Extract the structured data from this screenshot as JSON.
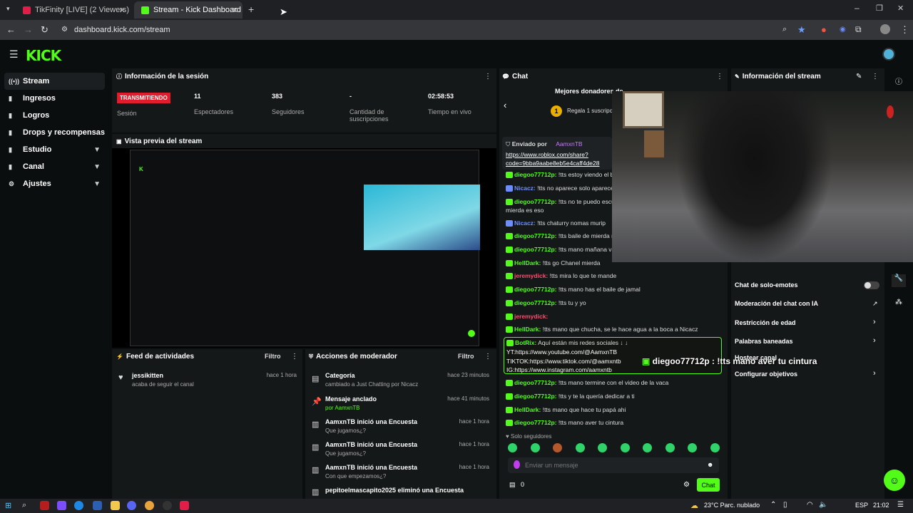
{
  "browser": {
    "tabs": [
      {
        "title": "TikFinity [LIVE] (2 Viewers)"
      },
      {
        "title": "Stream - Kick Dashboard"
      }
    ],
    "url": "dashboard.kick.com/stream"
  },
  "app": {
    "logo": "KICK"
  },
  "sidebar": {
    "items": [
      {
        "label": "Stream",
        "icon": "stream-icon"
      },
      {
        "label": "Ingresos",
        "icon": "money-icon"
      },
      {
        "label": "Logros",
        "icon": "trophy-icon"
      },
      {
        "label": "Drops y recompensas",
        "icon": "gift-icon"
      },
      {
        "label": "Estudio",
        "icon": "studio-icon"
      },
      {
        "label": "Canal",
        "icon": "channel-icon"
      },
      {
        "label": "Ajustes",
        "icon": "gear-icon"
      }
    ]
  },
  "session": {
    "title": "Información de la sesión",
    "live_badge": "TRANSMITIENDO",
    "session_label": "Sesión",
    "stats": [
      {
        "value": "11",
        "label": "Espectadores"
      },
      {
        "value": "383",
        "label": "Seguidores"
      },
      {
        "value": "-",
        "label": "Cantidad de suscripciones"
      },
      {
        "value": "02:58:53",
        "label": "Tiempo en vivo"
      }
    ]
  },
  "preview": {
    "title": "Vista previa del stream"
  },
  "feed": {
    "title": "Feed de actividades",
    "filter": "Filtro",
    "items": [
      {
        "user": "jessikitten",
        "text": "acaba de seguir el canal",
        "time": "hace 1 hora"
      }
    ]
  },
  "mod_actions": {
    "title": "Acciones de moderador",
    "filter": "Filtro",
    "items": [
      {
        "title": "Categoría",
        "subtitle": "cambiado a Just Chatting por Nicacz",
        "time": "hace 23 minutos"
      },
      {
        "title": "Mensaje anclado",
        "subtitle": "por AamxnTB",
        "time": "hace 41 minutos"
      },
      {
        "title": "AamxnTB inició una Encuesta",
        "subtitle": "Que jugamos¿?",
        "time": "hace 1 hora"
      },
      {
        "title": "AamxnTB inició una Encuesta",
        "subtitle": "Que jugamos¿?",
        "time": "hace 1 hora"
      },
      {
        "title": "AamxnTB inició una Encuesta",
        "subtitle": "Con que empezamos¿?",
        "time": "hace 1 hora"
      },
      {
        "title": "pepitoelmascapito2025 eliminó una Encuesta",
        "subtitle": "",
        "time": ""
      }
    ]
  },
  "chat": {
    "title": "Chat",
    "top_donors": "Mejores donadores de",
    "gift_text": "Regala 1 suscripci",
    "pinned_by": "Enviado por",
    "pinned_user": "AamxnTB",
    "pinned_link": "https://www.roblox.com/share?",
    "pinned_link2": "code=9bba9aabe8eb5e4caff4de28",
    "messages": [
      {
        "user": "diegoo77712p:",
        "text": "!tts estoy viendo el ba",
        "color": "#53fc18"
      },
      {
        "user": "Nicacz:",
        "text": "!tts no aparece solo aparece",
        "color": "#6d8dff"
      },
      {
        "user": "diegoo77712p:",
        "text": "!tts no te puedo escu",
        "color": "#53fc18"
      },
      {
        "user": "",
        "text": "mierda es eso",
        "color": "#ddd"
      },
      {
        "user": "Nicacz:",
        "text": "!tts chaturry nomas murip",
        "color": "#6d8dff"
      },
      {
        "user": "diegoo77712p:",
        "text": "!tts baile de mierda m",
        "color": "#53fc18"
      },
      {
        "user": "diegoo77712p:",
        "text": "!tts mano mañana va",
        "color": "#53fc18"
      },
      {
        "user": "HellDark:",
        "text": "!tts go Chanel mierda",
        "color": "#53fc18"
      },
      {
        "user": "jeremydick:",
        "text": "!tts mira lo que te mande",
        "color": "#ff4d6d"
      },
      {
        "user": "diegoo77712p:",
        "text": "!tts mano has el baile de jamal",
        "color": "#53fc18"
      },
      {
        "user": "diegoo77712p:",
        "text": "!tts tu y yo",
        "color": "#53fc18"
      },
      {
        "user": "jeremydick:",
        "text": "",
        "color": "#ff4d6d"
      },
      {
        "user": "HellDark:",
        "text": "!tts mano que chucha, se le hace agua a la boca a Nicacz",
        "color": "#53fc18"
      }
    ],
    "bot": {
      "user": "BotRix:",
      "line1": "Aquí están mis redes sociales ↓ ↓",
      "line2": "YT:https://www.youtube.com/@AamxnTB",
      "line3": "TIKTOK:https://www.tiktok.com/@aamxntb",
      "line4": "IG:https://www.instagram.com/aamxntb"
    },
    "messages2": [
      {
        "user": "diegoo77712p:",
        "text": "!tts mano termine con el video de la vaca"
      },
      {
        "user": "diegoo77712p:",
        "text": "!tts y te la quería dedicar a ti"
      },
      {
        "user": "HellDark:",
        "text": "!tts mano que hace tu papá ahi"
      },
      {
        "user": "diegoo77712p:",
        "text": "!tts mano aver tu cintura"
      }
    ],
    "followers_only": "Solo seguidores",
    "input_placeholder": "Enviar un mensaje",
    "count": "0",
    "send": "Chat"
  },
  "overlay_alert": "diegoo77712p : !tts mano aver tu cintura",
  "stream_info": {
    "title": "Información del stream",
    "rows": [
      {
        "label": "Chat de solo-emotes"
      },
      {
        "label": "Moderación del chat con IA"
      },
      {
        "label": "Restricción de edad"
      },
      {
        "label": "Palabras baneadas"
      },
      {
        "label": "Hostear canal"
      },
      {
        "label": "Configurar objetivos"
      }
    ]
  },
  "taskbar": {
    "weather": "23°C  Parc. nublado",
    "lang": "ESP",
    "time": "21:02"
  },
  "colors": {
    "accent": "#53fc18",
    "live": "#e11d2d",
    "panel": "#151819"
  }
}
